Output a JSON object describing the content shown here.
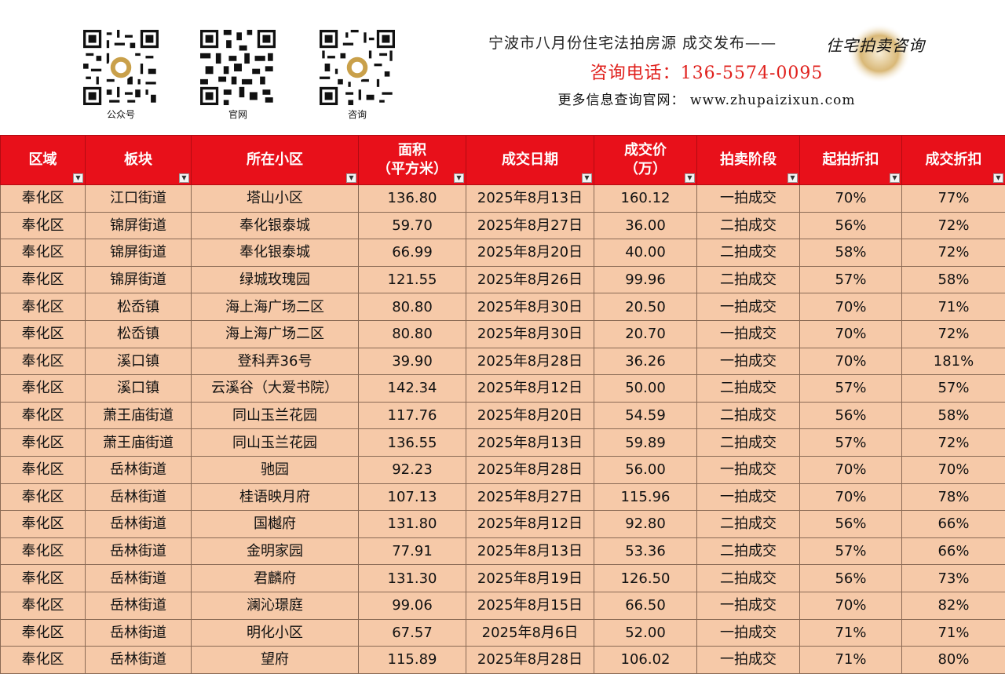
{
  "header": {
    "qr_codes": [
      {
        "label": "公众号",
        "icon": "qr-code-icon"
      },
      {
        "label": "官网",
        "icon": "qr-code-icon"
      },
      {
        "label": "咨询",
        "icon": "qr-code-icon"
      }
    ],
    "title": "宁波市八月份住宅法拍房源 成交发布——",
    "brand": "住宅拍卖咨询",
    "phone": "咨询电话：136-5574-0095",
    "website": "更多信息查询官网： www.zhupaizixun.com",
    "colors": {
      "accent": "#e8101a",
      "row_bg": "#f6c9a8",
      "phone": "#e0201c"
    }
  },
  "table": {
    "columns": [
      {
        "line1": "区域",
        "line2": ""
      },
      {
        "line1": "板块",
        "line2": ""
      },
      {
        "line1": "所在小区",
        "line2": ""
      },
      {
        "line1": "面积",
        "line2": "（平方米）"
      },
      {
        "line1": "成交日期",
        "line2": ""
      },
      {
        "line1": "成交价",
        "line2": "（万）"
      },
      {
        "line1": "拍卖阶段",
        "line2": ""
      },
      {
        "line1": "起拍折扣",
        "line2": ""
      },
      {
        "line1": "成交折扣",
        "line2": ""
      }
    ],
    "rows": [
      [
        "奉化区",
        "江口街道",
        "塔山小区",
        "136.80",
        "2025年8月13日",
        "160.12",
        "一拍成交",
        "70%",
        "77%"
      ],
      [
        "奉化区",
        "锦屏街道",
        "奉化银泰城",
        "59.70",
        "2025年8月27日",
        "36.00",
        "二拍成交",
        "56%",
        "72%"
      ],
      [
        "奉化区",
        "锦屏街道",
        "奉化银泰城",
        "66.99",
        "2025年8月20日",
        "40.00",
        "二拍成交",
        "58%",
        "72%"
      ],
      [
        "奉化区",
        "锦屏街道",
        "绿城玫瑰园",
        "121.55",
        "2025年8月26日",
        "99.96",
        "二拍成交",
        "57%",
        "58%"
      ],
      [
        "奉化区",
        "松岙镇",
        "海上海广场二区",
        "80.80",
        "2025年8月30日",
        "20.50",
        "一拍成交",
        "70%",
        "71%"
      ],
      [
        "奉化区",
        "松岙镇",
        "海上海广场二区",
        "80.80",
        "2025年8月30日",
        "20.70",
        "一拍成交",
        "70%",
        "72%"
      ],
      [
        "奉化区",
        "溪口镇",
        "登科弄36号",
        "39.90",
        "2025年8月28日",
        "36.26",
        "一拍成交",
        "70%",
        "181%"
      ],
      [
        "奉化区",
        "溪口镇",
        "云溪谷（大爱书院）",
        "142.34",
        "2025年8月12日",
        "50.00",
        "二拍成交",
        "57%",
        "57%"
      ],
      [
        "奉化区",
        "萧王庙街道",
        "同山玉兰花园",
        "117.76",
        "2025年8月20日",
        "54.59",
        "二拍成交",
        "56%",
        "58%"
      ],
      [
        "奉化区",
        "萧王庙街道",
        "同山玉兰花园",
        "136.55",
        "2025年8月13日",
        "59.89",
        "二拍成交",
        "57%",
        "72%"
      ],
      [
        "奉化区",
        "岳林街道",
        "驰园",
        "92.23",
        "2025年8月28日",
        "56.00",
        "一拍成交",
        "70%",
        "70%"
      ],
      [
        "奉化区",
        "岳林街道",
        "桂语映月府",
        "107.13",
        "2025年8月27日",
        "115.96",
        "一拍成交",
        "70%",
        "78%"
      ],
      [
        "奉化区",
        "岳林街道",
        "国樾府",
        "131.80",
        "2025年8月12日",
        "92.80",
        "二拍成交",
        "56%",
        "66%"
      ],
      [
        "奉化区",
        "岳林街道",
        "金明家园",
        "77.91",
        "2025年8月13日",
        "53.36",
        "二拍成交",
        "57%",
        "66%"
      ],
      [
        "奉化区",
        "岳林街道",
        "君麟府",
        "131.30",
        "2025年8月19日",
        "126.50",
        "二拍成交",
        "56%",
        "73%"
      ],
      [
        "奉化区",
        "岳林街道",
        "澜沁璟庭",
        "99.06",
        "2025年8月15日",
        "66.50",
        "一拍成交",
        "70%",
        "82%"
      ],
      [
        "奉化区",
        "岳林街道",
        "明化小区",
        "67.57",
        "2025年8月6日",
        "52.00",
        "一拍成交",
        "71%",
        "71%"
      ],
      [
        "奉化区",
        "岳林街道",
        "望府",
        "115.89",
        "2025年8月28日",
        "106.02",
        "一拍成交",
        "71%",
        "80%"
      ]
    ]
  }
}
